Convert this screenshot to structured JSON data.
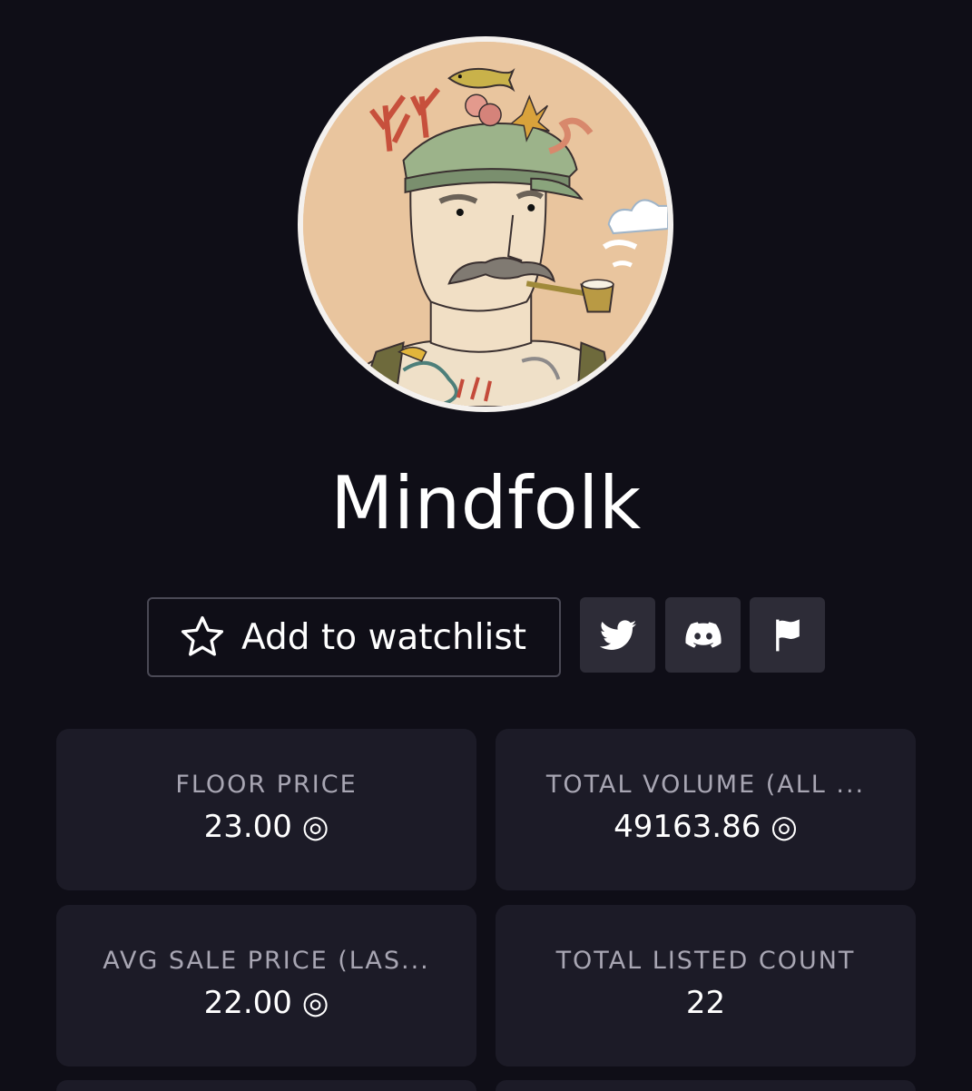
{
  "collection": {
    "name": "Mindfolk"
  },
  "actions": {
    "watchlist_label": "Add to watchlist",
    "icons": [
      "twitter-icon",
      "discord-icon",
      "flag-icon"
    ]
  },
  "stats": [
    {
      "label": "FLOOR PRICE",
      "value": "23.00 ◎"
    },
    {
      "label": "TOTAL VOLUME (ALL ...",
      "value": "49163.86 ◎"
    },
    {
      "label": "AVG SALE PRICE (LAS...",
      "value": "22.00 ◎"
    },
    {
      "label": "TOTAL LISTED COUNT",
      "value": "22"
    }
  ],
  "colors": {
    "background": "#0f0e17",
    "card": "#1c1b27",
    "icon_button": "#2d2c37",
    "label": "#a8a6b3"
  }
}
